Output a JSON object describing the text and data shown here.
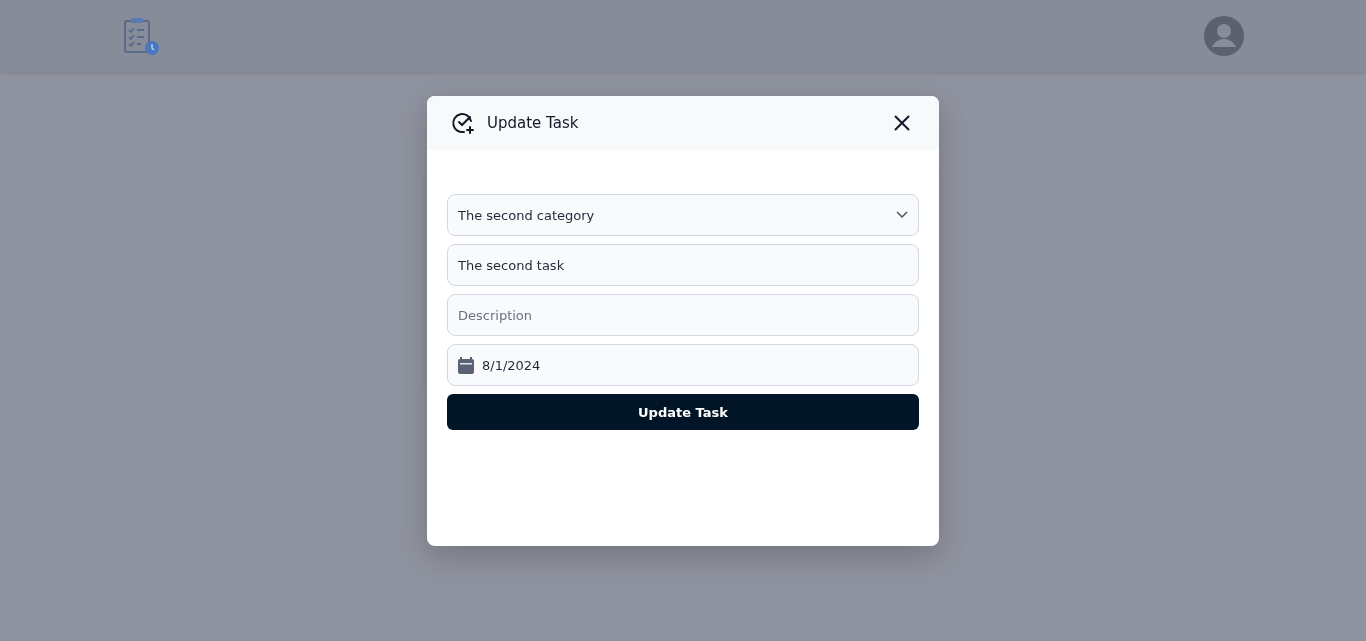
{
  "dialog": {
    "title": "Update Task",
    "fields": [
      {
        "kind": "select",
        "value": "The second category"
      },
      {
        "kind": "text",
        "value": "The second task"
      },
      {
        "kind": "text",
        "placeholder": "Description"
      },
      {
        "kind": "date",
        "value": "8/1/2024"
      }
    ],
    "submit": "Update Task"
  }
}
